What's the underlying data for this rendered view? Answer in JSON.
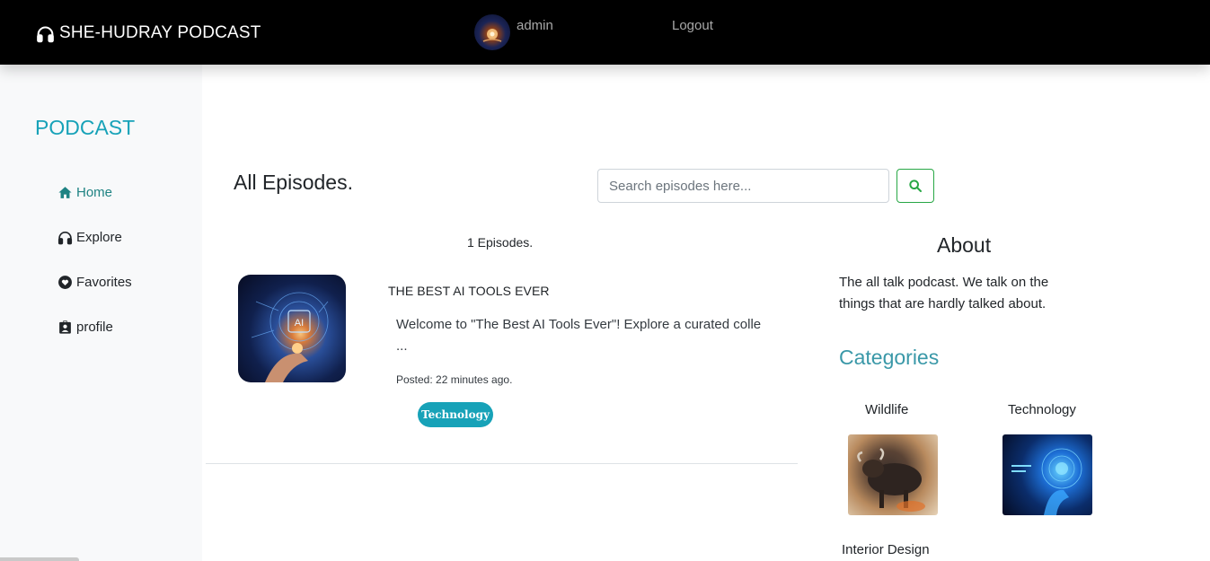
{
  "navbar": {
    "brand": "SHE-HUDRAY PODCAST",
    "brand_icon": "headphones-icon",
    "username": "admin",
    "logout_label": "Logout"
  },
  "sidebar": {
    "title": "PODCAST",
    "items": [
      {
        "label": "Home",
        "icon": "home-icon",
        "active": true
      },
      {
        "label": "Explore",
        "icon": "headphones-icon",
        "active": false
      },
      {
        "label": "Favorites",
        "icon": "heart-icon",
        "active": false
      },
      {
        "label": "profile",
        "icon": "id-badge-icon",
        "active": false
      }
    ]
  },
  "main": {
    "title": "All Episodes.",
    "search": {
      "placeholder": "Search episodes here...",
      "value": ""
    },
    "episode_count": "1 Episodes.",
    "episodes": [
      {
        "title": "THE BEST AI TOOLS EVER",
        "description": "Welcome to \"The Best AI Tools Ever\"! Explore a curated colle ...",
        "posted": "Posted: 22 minutes ago.",
        "category": "Technology"
      }
    ]
  },
  "about": {
    "title": "About",
    "text": "The all talk podcast. We talk on the things that are hardly talked about."
  },
  "categories": {
    "title": "Categories",
    "items": [
      {
        "label": "Wildlife"
      },
      {
        "label": "Technology"
      },
      {
        "label": "Interior Design"
      }
    ]
  },
  "colors": {
    "accent": "#17a2b8",
    "active_link": "#1f8383",
    "search_button": "#28a745",
    "navbar": "#000000"
  }
}
